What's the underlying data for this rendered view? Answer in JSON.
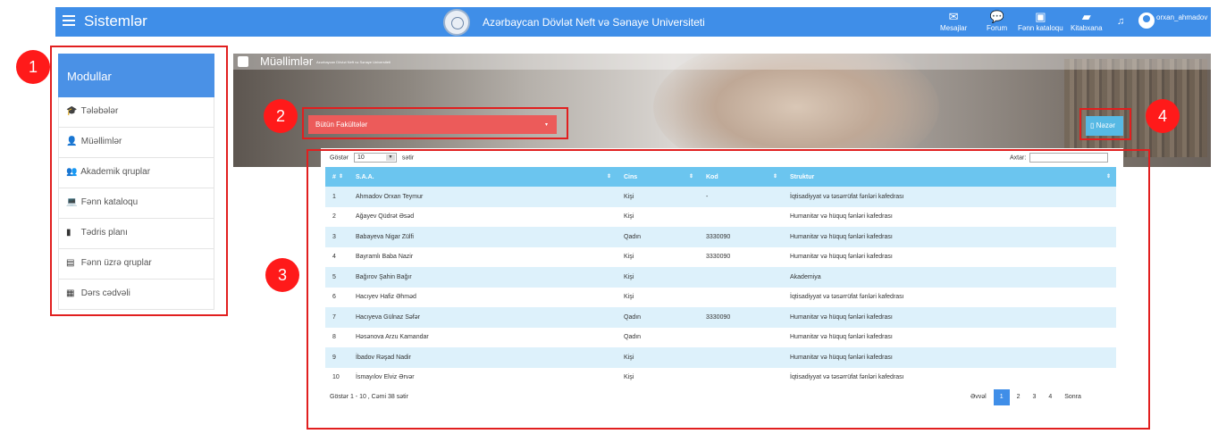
{
  "topbar": {
    "brand": "Sistemlər",
    "university": "Azərbaycan Dövlət Neft və Sənaye Universiteti",
    "nav": [
      {
        "label": "Mesajlar",
        "icon": "envelope-icon"
      },
      {
        "label": "Forum",
        "icon": "chat-icon"
      },
      {
        "label": "Fənn kataloqu",
        "icon": "book-catalog-icon"
      },
      {
        "label": "Kitabxana",
        "icon": "library-icon"
      }
    ],
    "username": "orxan_ahmadov"
  },
  "sidebar": {
    "title": "Modullar",
    "items": [
      {
        "label": "Tələbələr",
        "icon": "graduation-cap-icon"
      },
      {
        "label": "Müəllimlər",
        "icon": "user-icon"
      },
      {
        "label": "Akademik qruplar",
        "icon": "users-group-icon"
      },
      {
        "label": "Fənn kataloqu",
        "icon": "laptop-icon"
      },
      {
        "label": "Tədris planı",
        "icon": "bookmark-icon"
      },
      {
        "label": "Fənn üzrə qruplar",
        "icon": "file-icon"
      },
      {
        "label": "Dərs cədvəli",
        "icon": "calendar-icon"
      }
    ]
  },
  "header": {
    "title": "Müəllimlər",
    "subtitle": "Azərbaycan Dövlət Neft və Sənaye Universiteti",
    "faculty_select": "Bütün Fakültələr",
    "view_button": "Nəzər"
  },
  "table": {
    "show_label": "Göstər",
    "page_size": "10",
    "rows_label": "sətir",
    "search_label": "Axtar:",
    "columns": [
      "#",
      "S.A.A.",
      "Cins",
      "Kod",
      "Struktur"
    ],
    "rows": [
      [
        "1",
        "Ahmadov Orxan Teymur",
        "Kişi",
        "-",
        "İqtisadiyyat və təsərrüfat fənləri kafedrası"
      ],
      [
        "2",
        "Ağayev Qüdrət Əsəd",
        "Kişi",
        "",
        "Humanitar və hüquq fənləri kafedrası"
      ],
      [
        "3",
        "Babayeva Nigar Zülfi",
        "Qadın",
        "3330090",
        "Humanitar və hüquq fənləri kafedrası"
      ],
      [
        "4",
        "Bayramlı Baba Nazir",
        "Kişi",
        "3330090",
        "Humanitar və hüquq fənləri kafedrası"
      ],
      [
        "5",
        "Bağırov Şahin Bağır",
        "Kişi",
        "",
        "Akademiya"
      ],
      [
        "6",
        "Hacıyev Hafiz Əhməd",
        "Kişi",
        "",
        "İqtisadiyyat və təsərrüfat fənləri kafedrası"
      ],
      [
        "7",
        "Hacıyeva Gülnaz Səfər",
        "Qadın",
        "3330090",
        "Humanitar və hüquq fənləri kafedrası"
      ],
      [
        "8",
        "Həsənova Arzu Kamandar",
        "Qadın",
        "",
        "Humanitar və hüquq fənləri kafedrası"
      ],
      [
        "9",
        "İbadov Rəşad Nadir",
        "Kişi",
        "",
        "Humanitar və hüquq fənləri kafedrası"
      ],
      [
        "10",
        "İsmayılov Elviz Ərvər",
        "Kişi",
        "",
        "İqtisadiyyat və təsərrüfat fənləri kafedrası"
      ]
    ],
    "footer_info": "Göstər 1 - 10 , Cəmi 38 sətir",
    "pagination": [
      "Əvvəl",
      "1",
      "2",
      "3",
      "4",
      "Sonra"
    ],
    "active_page": "1"
  },
  "annotations": [
    "1",
    "2",
    "3",
    "4"
  ],
  "colors": {
    "primary": "#3f8ee8",
    "table_header": "#6bc5ef",
    "faculty_select": "#ec5b5a",
    "annotation": "#ff1a1a"
  }
}
